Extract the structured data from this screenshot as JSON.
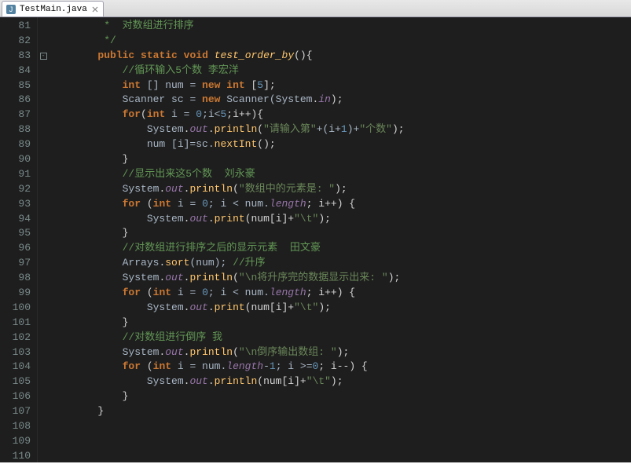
{
  "tab": {
    "filename": "TestMain.java"
  },
  "lineStart": 81,
  "lineEnd": 110,
  "foldOnLine": 83,
  "code": {
    "l81": {
      "indent": "         ",
      "doc": "*  对数组进行排序"
    },
    "l82": {
      "indent": "         ",
      "doc": "*/"
    },
    "l83": {
      "indent": "        ",
      "kw1": "public",
      "kw2": "static",
      "kw3": "void",
      "method": "test_order_by",
      "tail": "(){"
    },
    "l84": {
      "indent": "            ",
      "comment": "//循环输入5个数 李宏洋"
    },
    "l85": {
      "indent": "            ",
      "kw": "int",
      "txt1": " [] num = ",
      "kw2": "new",
      "txt2": " ",
      "kw3": "int",
      "txt3": " [",
      "num": "5",
      "txt4": "];"
    },
    "l86": {
      "indent": "            ",
      "cls": "Scanner",
      "txt1": " sc = ",
      "kw": "new",
      "txt2": " Scanner(",
      "cls2": "System",
      "txt3": ".",
      "field": "in",
      "txt4": ");"
    },
    "l87": {
      "indent": "            ",
      "kw": "for",
      "txt1": "(",
      "kw2": "int",
      "txt2": " i = ",
      "n1": "0",
      "txt3": ";i<",
      "n2": "5",
      "txt4": ";i++){"
    },
    "l88": {
      "indent": "                ",
      "cls": "System",
      "p1": ".",
      "field": "out",
      "p2": ".",
      "call": "println",
      "txt1": "(",
      "str1": "\"请输入第\"",
      "txt2": "+(i+",
      "n": "1",
      "txt3": ")+",
      "str2": "\"个数\"",
      "txt4": ");"
    },
    "l89": {
      "indent": "                ",
      "txt1": "num [i]=sc.",
      "call": "nextInt",
      "txt2": "();"
    },
    "l90": {
      "indent": "            ",
      "txt": "}"
    },
    "l91": {
      "indent": "            ",
      "comment": "//显示出来这5个数  刘永豪"
    },
    "l92": {
      "indent": "            ",
      "cls": "System",
      "p1": ".",
      "field": "out",
      "p2": ".",
      "call": "println",
      "txt1": "(",
      "str": "\"数组中的元素是: \"",
      "txt2": ");"
    },
    "l93": {
      "indent": "            ",
      "kw": "for",
      "txt1": " (",
      "kw2": "int",
      "txt2": " i = ",
      "n1": "0",
      "txt3": "; i < num.",
      "field": "length",
      "txt4": "; i++) {"
    },
    "l94": {
      "indent": "                ",
      "cls": "System",
      "p1": ".",
      "field": "out",
      "p2": ".",
      "call": "print",
      "txt1": "(num[i]+",
      "str": "\"\\t\"",
      "txt2": ");"
    },
    "l95": {
      "indent": "            ",
      "txt": "}"
    },
    "l96": {
      "indent": "            ",
      "comment": "//对数组进行排序之后的显示元素  田文豪"
    },
    "l97": {
      "indent": "            ",
      "cls": "Arrays",
      "p1": ".",
      "call": "sort",
      "txt1": "(num); ",
      "comment": "//升序"
    },
    "l98": {
      "indent": "            ",
      "cls": "System",
      "p1": ".",
      "field": "out",
      "p2": ".",
      "call": "println",
      "txt1": "(",
      "str": "\"\\n将升序完的数据显示出来: \"",
      "txt2": ");"
    },
    "l99": {
      "indent": "            ",
      "kw": "for",
      "txt1": " (",
      "kw2": "int",
      "txt2": " i = ",
      "n1": "0",
      "txt3": "; i < num.",
      "field": "length",
      "txt4": "; i++) {"
    },
    "l100": {
      "indent": "                ",
      "cls": "System",
      "p1": ".",
      "field": "out",
      "p2": ".",
      "call": "print",
      "txt1": "(num[i]+",
      "str": "\"\\t\"",
      "txt2": ");"
    },
    "l101": {
      "indent": "            ",
      "txt": "}"
    },
    "l102": {
      "indent": "            ",
      "comment": "//对数组进行倒序 我"
    },
    "l103": {
      "indent": "            ",
      "cls": "System",
      "p1": ".",
      "field": "out",
      "p2": ".",
      "call": "println",
      "txt1": "(",
      "str": "\"\\n倒序输出数组: \"",
      "txt2": ");"
    },
    "l104": {
      "indent": "            ",
      "kw": "for",
      "txt1": " (",
      "kw2": "int",
      "txt2": " i = num.",
      "field": "length",
      "txt3": "-",
      "n1": "1",
      "txt4": "; i >=",
      "n2": "0",
      "txt5": "; i--) {"
    },
    "l105": {
      "indent": "                ",
      "cls": "System",
      "p1": ".",
      "field": "out",
      "p2": ".",
      "call": "println",
      "txt1": "(num[i]+",
      "str": "\"\\t\"",
      "txt2": ");"
    },
    "l106": {
      "indent": "            ",
      "txt": "}"
    },
    "l107": {
      "indent": "        ",
      "txt": "}"
    },
    "l108": {
      "indent": "",
      "txt": ""
    },
    "l109": {
      "indent": "",
      "txt": ""
    },
    "l110": {
      "indent": "",
      "txt": ""
    }
  }
}
